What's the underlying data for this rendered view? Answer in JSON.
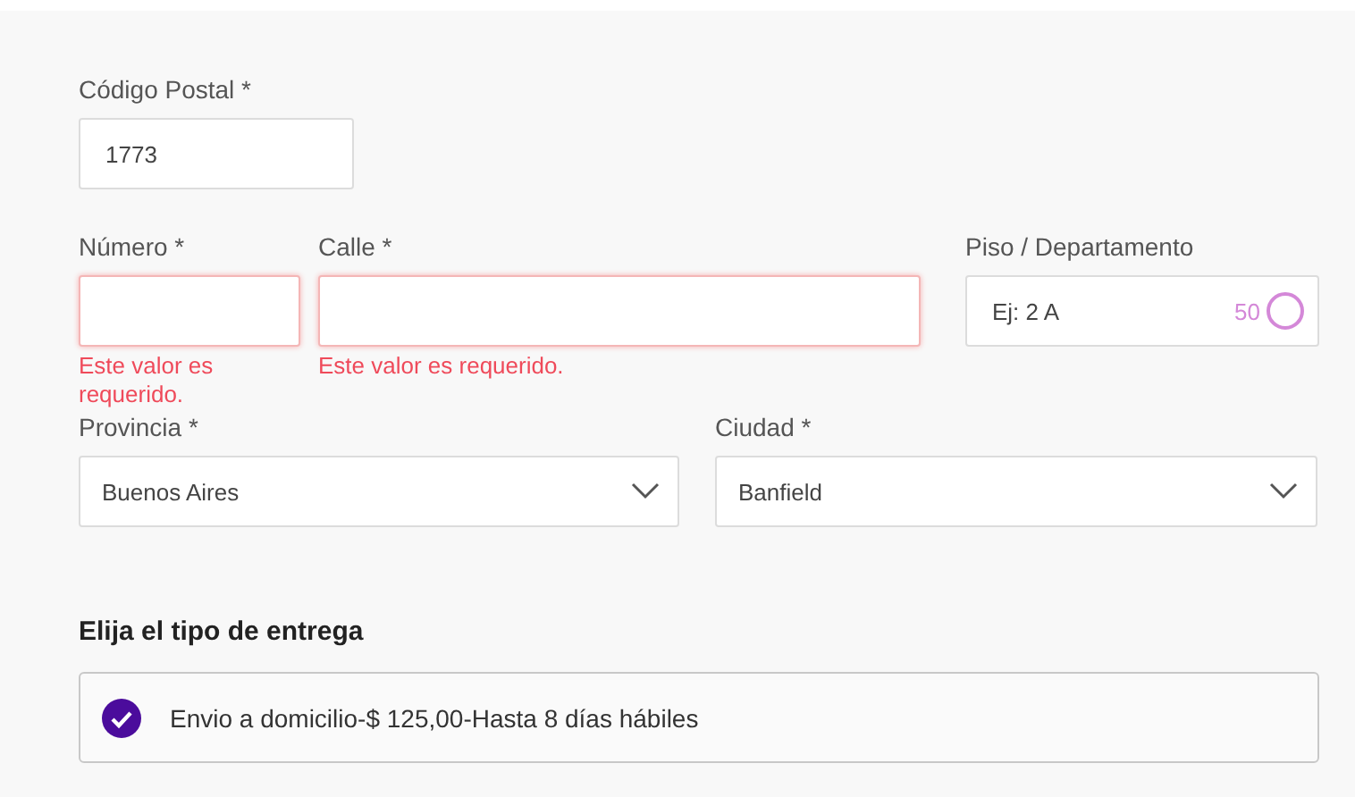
{
  "postal_code": {
    "label": "Código Postal *",
    "value": "1773"
  },
  "numero": {
    "label": "Número *",
    "error": "Este valor es requerido."
  },
  "calle": {
    "label": "Calle *",
    "error": "Este valor es requerido."
  },
  "piso": {
    "label": "Piso / Departamento",
    "placeholder": "Ej: 2 A",
    "counter": "50"
  },
  "provincia": {
    "label": "Provincia *",
    "value": "Buenos Aires"
  },
  "ciudad": {
    "label": "Ciudad *",
    "value": "Banfield"
  },
  "delivery": {
    "title": "Elija el tipo de entrega",
    "options": [
      {
        "label": "Envio a domicilio-$ 125,00-Hasta 8 días hábiles",
        "selected": true
      }
    ]
  }
}
